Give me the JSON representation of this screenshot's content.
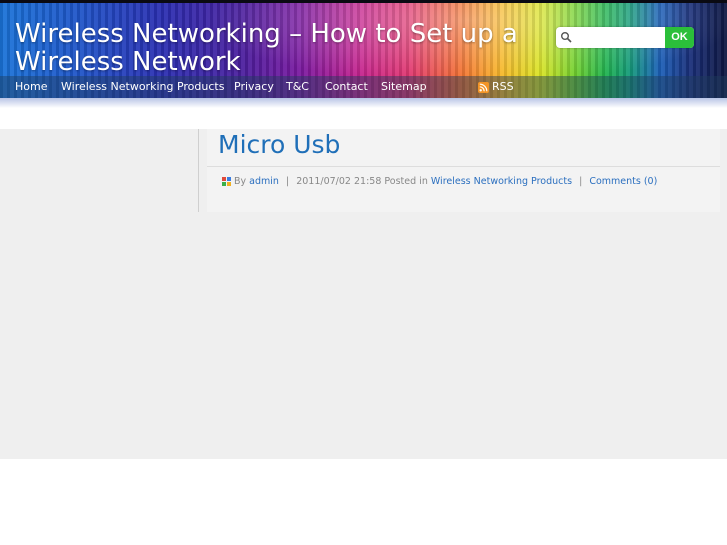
{
  "header": {
    "site_title": "Wireless Networking – How to Set up a Wireless Network",
    "search": {
      "placeholder": "",
      "value": "",
      "button_label": "OK"
    },
    "nav": [
      "Home",
      "Wireless Networking Products",
      "Privacy",
      "T&C",
      "Contact",
      "Sitemap"
    ],
    "rss_label": "RSS"
  },
  "post": {
    "title": "Micro Usb",
    "meta": {
      "by_label": "By",
      "author": "admin",
      "separator": "|",
      "datetime": "2011/07/02 21:58",
      "posted_in_label": "Posted in",
      "category": "Wireless Networking Products",
      "comments": "Comments (0)"
    }
  },
  "colors": {
    "link_blue": "#1f6fb8",
    "ok_green": "#2bbf3a",
    "content_bg": "#efefef",
    "rss_orange": "#f39426"
  }
}
